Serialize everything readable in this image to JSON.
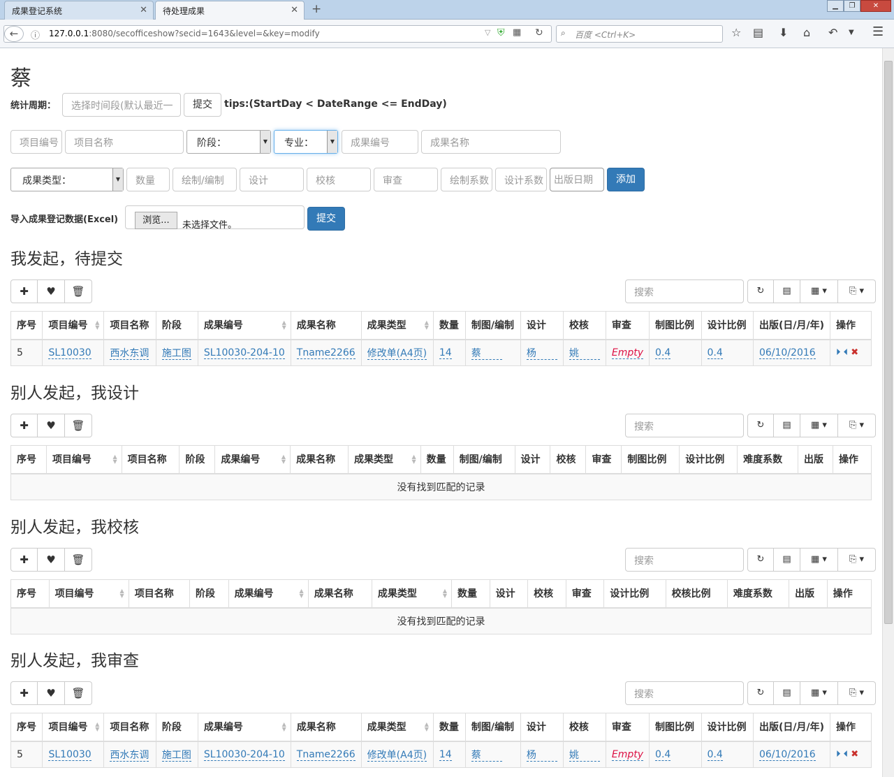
{
  "browser": {
    "tabs": [
      {
        "label": "成果登记系统",
        "active": false
      },
      {
        "label": "待处理成果",
        "active": true
      }
    ],
    "url_host": "127.0.0.1",
    "url_rest": ":8080/secofficeshow?secid=1643&level=&key=modify",
    "search_placeholder": "百度 <Ctrl+K>"
  },
  "page": {
    "title": "蔡",
    "period_label": "统计周期：",
    "period_placeholder": "选择时间段(默认最近一",
    "period_submit": "提交",
    "tips": "tips:(StartDay < DateRange <= EndDay)",
    "row1": {
      "project_no": "项目编号",
      "project_name": "项目名称",
      "stage": "阶段：",
      "major": "专业：",
      "result_no": "成果编号",
      "result_name": "成果名称"
    },
    "row2": {
      "result_type": "成果类型：",
      "count": "数量",
      "drawer": "绘制/编制",
      "design": "设计",
      "check": "校核",
      "review": "审查",
      "draw_ratio": "绘制系数",
      "design_ratio": "设计系数",
      "pub_date": "出版日期",
      "add": "添加"
    },
    "import_label": "导入成果登记数据(Excel)",
    "browse": "浏览...",
    "no_file": "未选择文件。",
    "import_submit": "提交",
    "search_placeholder": "搜索"
  },
  "sections": [
    {
      "title": "我发起，待提交",
      "headers": [
        "序号",
        "项目编号",
        "项目名称",
        "阶段",
        "成果编号",
        "成果名称",
        "成果类型",
        "数量",
        "制图/编制",
        "设计",
        "校核",
        "审查",
        "制图比例",
        "设计比例",
        "出版(日/月/年)",
        "操作"
      ],
      "rows": [
        [
          "5",
          "SL10030",
          "西水东调",
          "施工图",
          "SL10030-204-10",
          "Tname2266",
          "修改单(A4页)",
          "14",
          "蔡",
          "杨",
          "姚",
          "Empty",
          "0.4",
          "0.4",
          "06/10/2016"
        ]
      ],
      "empty": ""
    },
    {
      "title": "别人发起，我设计",
      "headers": [
        "序号",
        "项目编号",
        "项目名称",
        "阶段",
        "成果编号",
        "成果名称",
        "成果类型",
        "数量",
        "制图/编制",
        "设计",
        "校核",
        "审查",
        "制图比例",
        "设计比例",
        "难度系数",
        "出版",
        "操作"
      ],
      "rows": [],
      "empty": "没有找到匹配的记录"
    },
    {
      "title": "别人发起，我校核",
      "headers": [
        "序号",
        "项目编号",
        "项目名称",
        "阶段",
        "成果编号",
        "成果名称",
        "成果类型",
        "数量",
        "设计",
        "校核",
        "审查",
        "设计比例",
        "校核比例",
        "难度系数",
        "出版",
        "操作"
      ],
      "rows": [],
      "empty": "没有找到匹配的记录"
    },
    {
      "title": "别人发起，我审查",
      "headers": [
        "序号",
        "项目编号",
        "项目名称",
        "阶段",
        "成果编号",
        "成果名称",
        "成果类型",
        "数量",
        "制图/编制",
        "设计",
        "校核",
        "审查",
        "制图比例",
        "设计比例",
        "出版(日/月/年)",
        "操作"
      ],
      "rows": [
        [
          "5",
          "SL10030",
          "西水东调",
          "施工图",
          "SL10030-204-10",
          "Tname2266",
          "修改单(A4页)",
          "14",
          "蔡",
          "杨",
          "姚",
          "Empty",
          "0.4",
          "0.4",
          "06/10/2016"
        ]
      ],
      "empty": ""
    }
  ]
}
